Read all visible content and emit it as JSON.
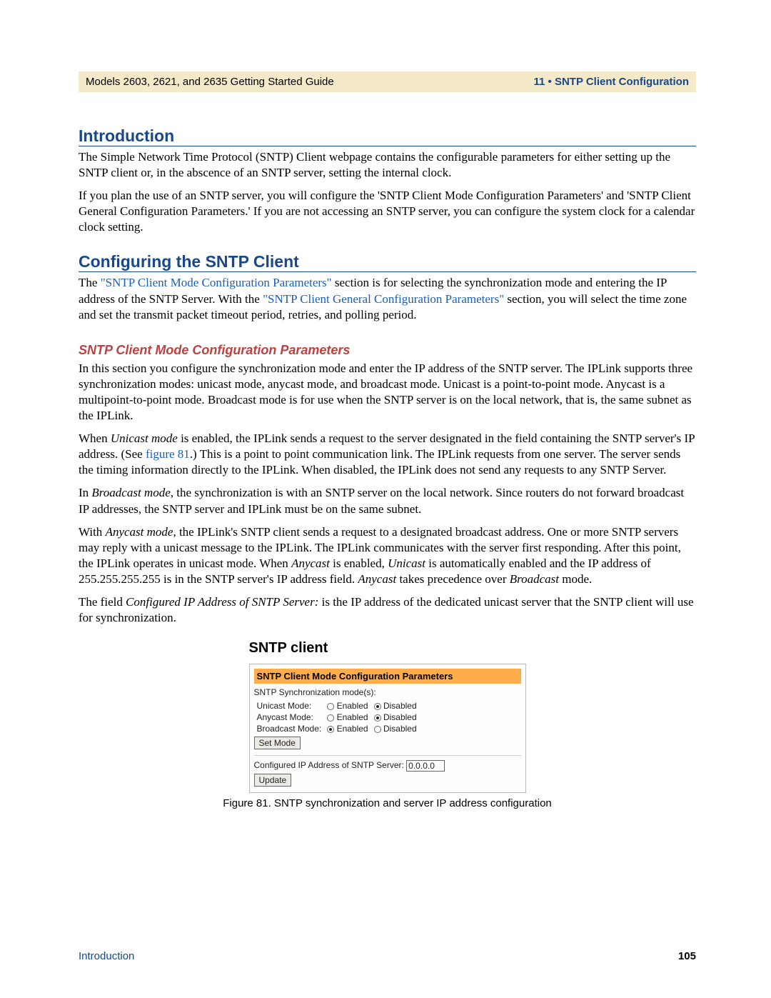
{
  "header": {
    "left": "Models 2603, 2621, and 2635 Getting Started Guide",
    "right": "11 • SNTP Client Configuration"
  },
  "sections": {
    "intro_heading": "Introduction",
    "intro_p1": "The Simple Network Time Protocol (SNTP) Client webpage contains the configurable parameters for either setting up the SNTP client or, in the abscence of an SNTP server, setting the internal clock.",
    "intro_p2": "If you plan the use of an SNTP server, you will configure the 'SNTP Client Mode Configuration Parameters' and 'SNTP Client General Configuration Parameters.' If you are not accessing an SNTP server, you can configure the system clock for a calendar clock setting.",
    "config_heading": "Configuring the SNTP Client",
    "config_p1_pre": "The ",
    "config_p1_link1": "\"SNTP Client Mode Configuration Parameters\"",
    "config_p1_mid": " section is for selecting the synchronization mode and entering the IP address of the SNTP Server. With the ",
    "config_p1_link2": "\"SNTP Client General Configuration Parameters\"",
    "config_p1_post": " section, you will select the time zone and set the transmit packet timeout period, retries, and polling period.",
    "mode_heading": "SNTP Client Mode Configuration Parameters",
    "mode_p1": "In this section you configure the synchronization mode and enter the IP address of the SNTP server. The IPLink supports three synchronization modes: unicast mode, anycast mode, and broadcast mode. Unicast is a point-to-point mode. Anycast is a multipoint-to-point mode. Broadcast mode is for use when the SNTP server is on the local network, that is, the same subnet as the IPLink.",
    "mode_p2_a": "When ",
    "mode_p2_em1": "Unicast mode",
    "mode_p2_b": " is enabled, the IPLink sends a request to the server designated in the field containing the SNTP server's IP address. (See ",
    "mode_p2_link": "figure 81",
    "mode_p2_c": ".) This is a point to point communication link. The IPLink requests from one server. The server sends the timing information directly to the IPLink. When disabled, the IPLink does not send any requests to any SNTP Server.",
    "mode_p3_a": "In ",
    "mode_p3_em": "Broadcast mode",
    "mode_p3_b": ", the synchronization is with an SNTP server on the local network. Since routers do not forward broadcast IP addresses, the SNTP server and IPLink must be on the same subnet.",
    "mode_p4_a": "With ",
    "mode_p4_em1": "Anycast mode",
    "mode_p4_b": ", the IPLink's SNTP client sends a request to a designated broadcast address. One or more SNTP servers may reply with a unicast message to the IPLink. The IPLink communicates with the server first responding. After this point, the IPLink operates in unicast mode. When ",
    "mode_p4_em2": "Anycast",
    "mode_p4_c": " is enabled, ",
    "mode_p4_em3": "Unicast",
    "mode_p4_d": " is automatically enabled and the IP address of 255.255.255.255 is in the SNTP server's IP address field. ",
    "mode_p4_em4": "Anycast",
    "mode_p4_e": " takes precedence over ",
    "mode_p4_em5": "Broadcast",
    "mode_p4_f": " mode.",
    "mode_p5_a": "The field ",
    "mode_p5_em": "Configured IP Address of SNTP Server:",
    "mode_p5_b": " is the IP address of the dedicated unicast server that the SNTP client will use for synchronization."
  },
  "figure": {
    "title": "SNTP client",
    "panel_heading": "SNTP Client Mode Configuration Parameters",
    "sync_label": "SNTP Synchronization mode(s):",
    "rows": [
      {
        "name": "Unicast Mode:",
        "enabled": "Enabled",
        "disabled": "Disabled",
        "selected": "disabled"
      },
      {
        "name": "Anycast Mode:",
        "enabled": "Enabled",
        "disabled": "Disabled",
        "selected": "disabled"
      },
      {
        "name": "Broadcast Mode:",
        "enabled": "Enabled",
        "disabled": "Disabled",
        "selected": "enabled"
      }
    ],
    "set_mode_btn": "Set Mode",
    "ip_label": "Configured IP Address of SNTP Server:",
    "ip_value": "0.0.0.0",
    "update_btn": "Update",
    "caption": "Figure 81. SNTP synchronization and server IP address configuration"
  },
  "footer": {
    "left": "Introduction",
    "right": "105"
  }
}
